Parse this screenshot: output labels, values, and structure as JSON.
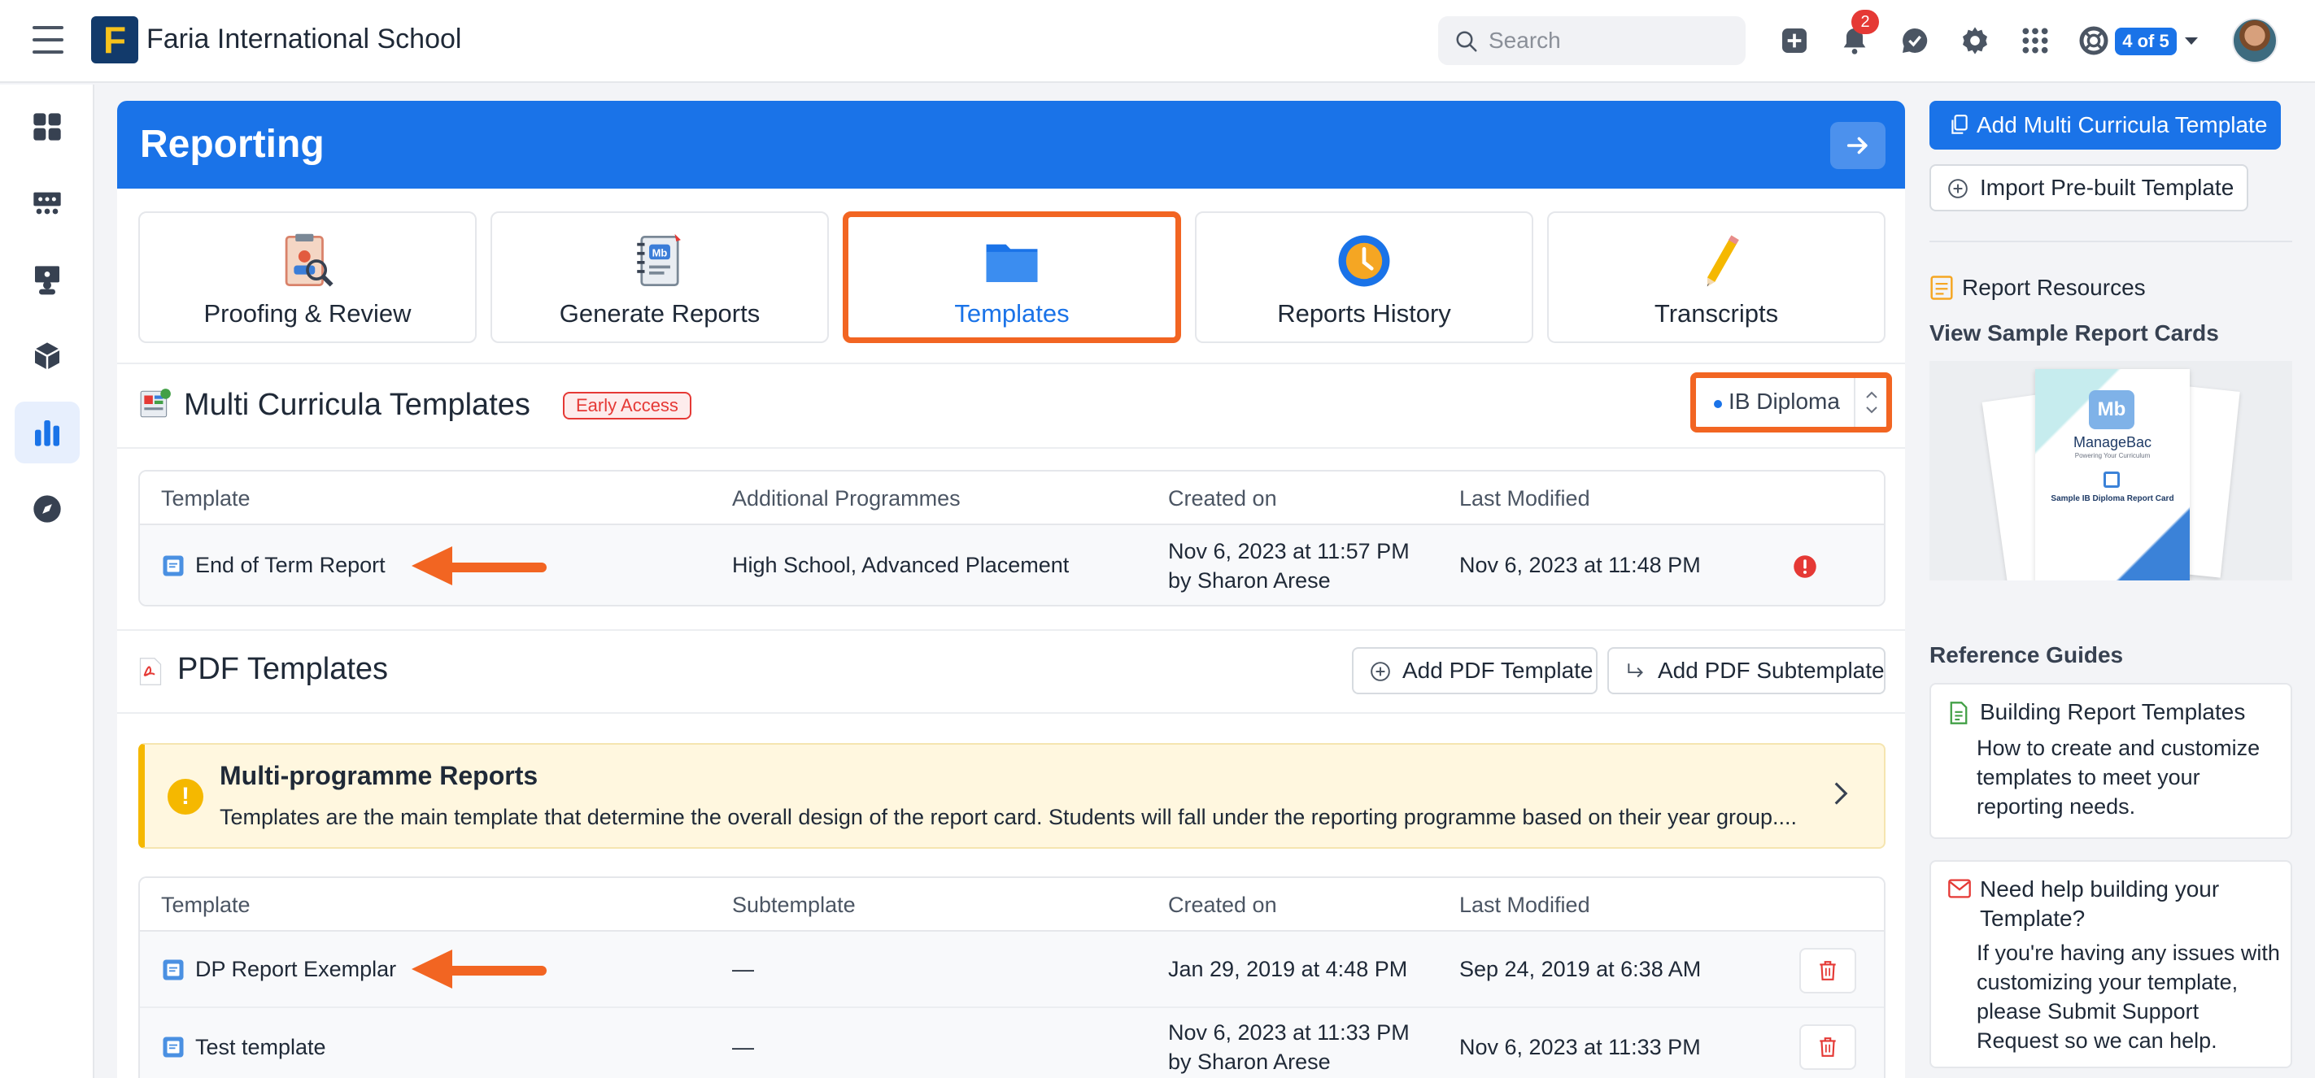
{
  "app": {
    "school_name": "Faria International School",
    "logo_letter": "F"
  },
  "topbar": {
    "search_placeholder": "Search",
    "notifications_count": "2",
    "switcher_label": "4 of 5"
  },
  "leftnav": {
    "items": [
      {
        "icon": "dashboard-icon"
      },
      {
        "icon": "classes-icon"
      },
      {
        "icon": "teacher-icon"
      },
      {
        "icon": "cube-icon"
      },
      {
        "icon": "bar-chart-icon",
        "active": true
      },
      {
        "icon": "compass-icon"
      }
    ]
  },
  "banner": {
    "title": "Reporting"
  },
  "tabs": [
    {
      "label": "Proofing & Review",
      "icon": "proofing-icon"
    },
    {
      "label": "Generate Reports",
      "icon": "report-cards-icon"
    },
    {
      "label": "Templates",
      "icon": "folder-icon",
      "active": true
    },
    {
      "label": "Reports History",
      "icon": "clock-icon"
    },
    {
      "label": "Transcripts",
      "icon": "pencil-icon"
    }
  ],
  "multi_curricula": {
    "title": "Multi Curricula Templates",
    "badge": "Early Access",
    "programme_select": "IB Diploma",
    "columns": [
      "Template",
      "Additional Programmes",
      "Created on",
      "Last Modified"
    ],
    "rows": [
      {
        "template": "End of Term Report",
        "additional_programmes": "High School, Advanced Placement",
        "created_on": "Nov 6, 2023 at 11:57 PM",
        "created_by": "by Sharon Arese",
        "last_modified": "Nov 6, 2023 at 11:48 PM"
      }
    ]
  },
  "pdf_templates": {
    "title": "PDF Templates",
    "add_template_label": "Add PDF Template",
    "add_subtemplate_label": "Add PDF Subtemplate",
    "alert": {
      "title": "Multi-programme Reports",
      "body": "Templates are the main template that determine the overall design of the report card. Students will fall under the reporting programme based on their year group...."
    },
    "columns": [
      "Template",
      "Subtemplate",
      "Created on",
      "Last Modified"
    ],
    "rows": [
      {
        "template": "DP Report Exemplar",
        "subtemplate": "—",
        "created_on": "Jan 29, 2019 at 4:48 PM",
        "created_by": "",
        "last_modified": "Sep 24, 2019 at 6:38 AM"
      },
      {
        "template": "Test template",
        "subtemplate": "—",
        "created_on": "Nov 6, 2023 at 11:33 PM",
        "created_by": "by Sharon Arese",
        "last_modified": "Nov 6, 2023 at 11:33 PM"
      }
    ]
  },
  "sidebar": {
    "add_multi_label": "Add Multi Curricula Template",
    "import_label": "Import Pre-built Template",
    "resources_title": "Report Resources",
    "sample_link": "View Sample Report Cards",
    "preview": {
      "brand": "ManageBac",
      "tagline": "Powering Your Curriculum",
      "caption": "Sample IB Diploma Report Card"
    },
    "reference_title": "Reference Guides",
    "guides": [
      {
        "title": "Building Report Templates",
        "desc": "How to create and customize templates to meet your reporting needs."
      },
      {
        "title": "Need help building your Template?",
        "desc": "If you're having any issues with customizing your template, please Submit Support Request so we can help."
      }
    ]
  },
  "colors": {
    "primary": "#1a73e8",
    "highlight": "#f26522",
    "danger": "#e53935",
    "warning": "#f5b800"
  }
}
